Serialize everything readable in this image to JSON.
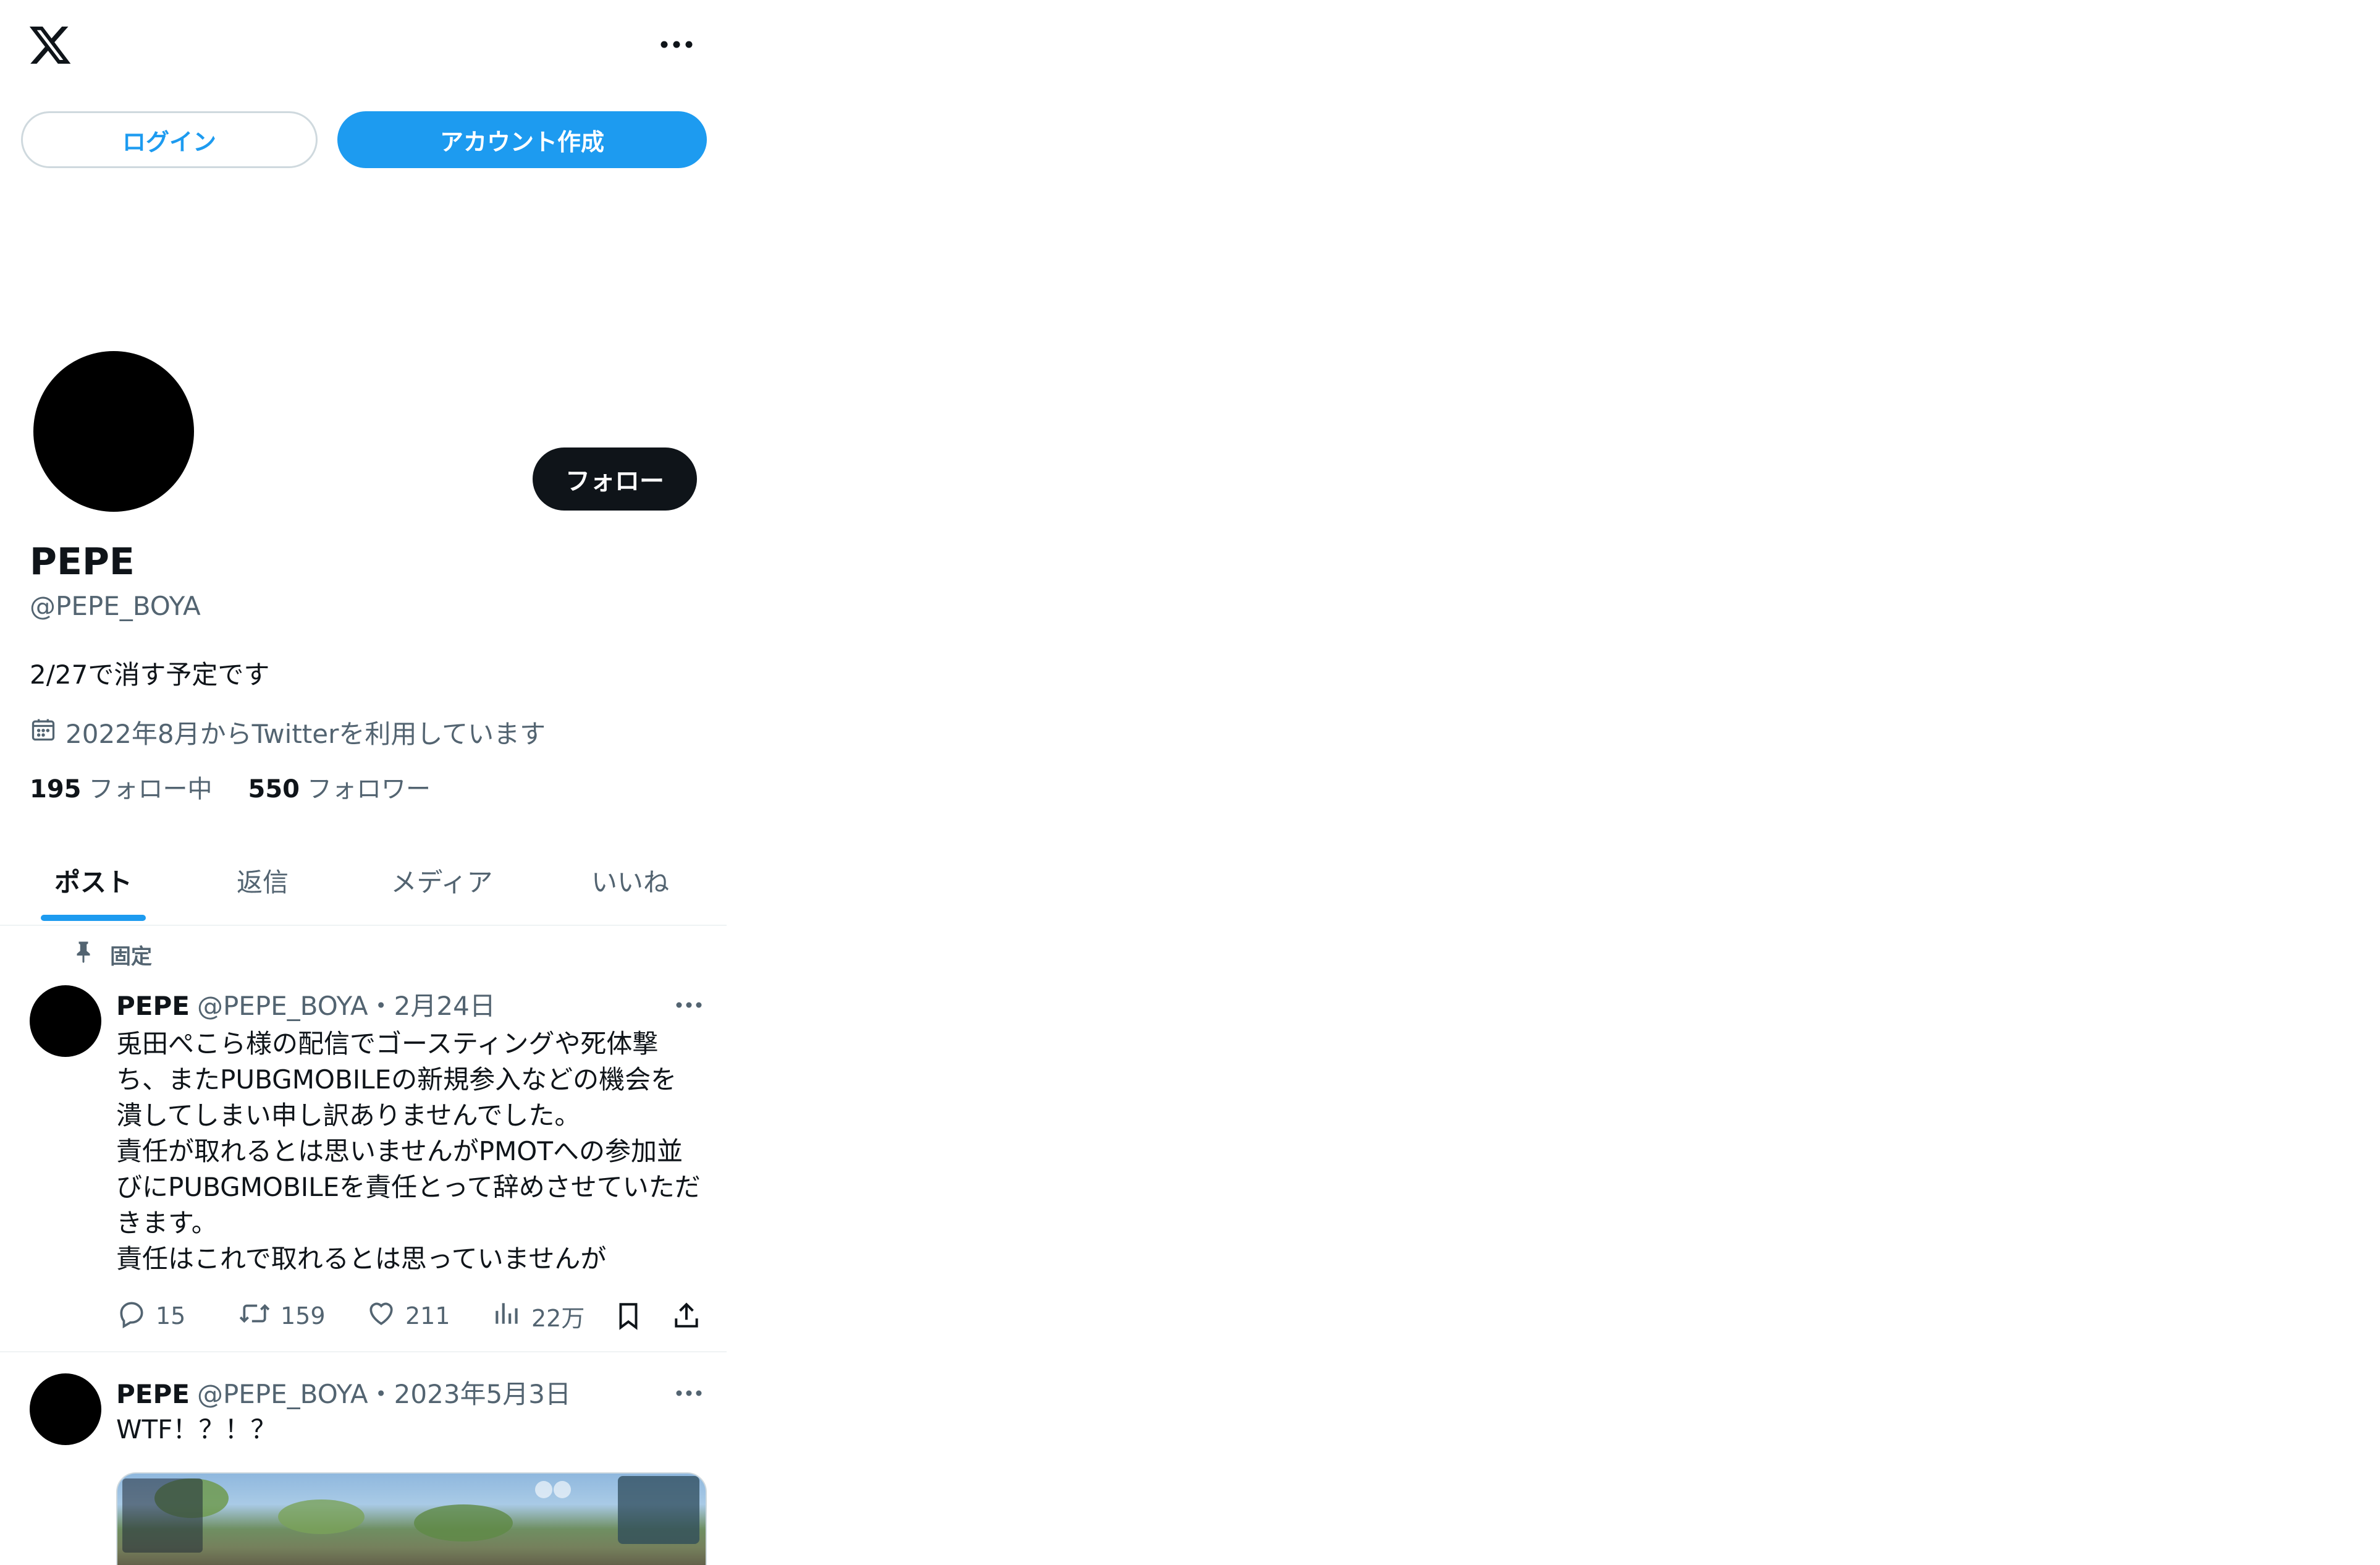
{
  "header": {
    "logo_icon": "x-logo-icon",
    "more_icon": "more-horizontal-icon"
  },
  "auth": {
    "login_label": "ログイン",
    "create_account_label": "アカウント作成"
  },
  "profile": {
    "follow_label": "フォロー",
    "display_name": "PEPE",
    "handle": "@PEPE_BOYA",
    "bio": "2/27で消す予定です",
    "joined": "2022年8月からTwitterを利用しています",
    "following_count": "195",
    "following_label": "フォロー中",
    "followers_count": "550",
    "followers_label": "フォロワー"
  },
  "tabs": [
    {
      "label": "ポスト",
      "active": true
    },
    {
      "label": "返信",
      "active": false
    },
    {
      "label": "メディア",
      "active": false
    },
    {
      "label": "いいね",
      "active": false
    }
  ],
  "posts": [
    {
      "pinned_label": "固定",
      "name": "PEPE",
      "handle": "@PEPE_BOYA",
      "dot": "・",
      "date": "2月24日",
      "lines": [
        "兎田ぺこら様の配信でゴースティングや死体撃",
        "ち、またPUBGMOBILEの新規参入などの機会を",
        "潰してしまい申し訳ありませんでした。",
        "責任が取れるとは思いませんがPMOTへの参加並",
        "びにPUBGMOBILEを責任とって辞めさせていただ",
        "きます。",
        "責任はこれで取れるとは思っていませんが"
      ],
      "replies": "15",
      "reposts": "159",
      "likes": "211",
      "views": "22万"
    },
    {
      "name": "PEPE",
      "handle": "@PEPE_BOYA",
      "dot": "・",
      "date": "2023年5月3日",
      "text": "WTF！？！？"
    }
  ],
  "colors": {
    "accent": "#1d9bf0",
    "text": "#0f1419",
    "muted": "#536471",
    "border": "#eff3f4"
  }
}
